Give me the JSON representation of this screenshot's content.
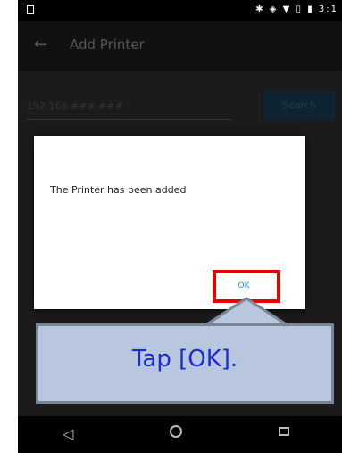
{
  "status_bar": {
    "icons_text": "✱ ◈ ▼ ▯ ▮ 3:1"
  },
  "app_bar": {
    "back_icon": "arrow-left-icon",
    "title": "Add Printer"
  },
  "form": {
    "ip_placeholder": "192.168.###.###",
    "search_label": "Search"
  },
  "dialog": {
    "message": "The Printer has been added",
    "ok_label": "OK"
  },
  "callout": {
    "text": "Tap [OK]."
  },
  "nav_bar": {
    "back_glyph": "◁",
    "home_icon": "home-icon",
    "recent_icon": "recent-apps-icon"
  },
  "colors": {
    "highlight": "#e60000",
    "callout_bg": "#b9c7de",
    "callout_text": "#1d2bd6",
    "ok_text": "#1e88e5"
  }
}
